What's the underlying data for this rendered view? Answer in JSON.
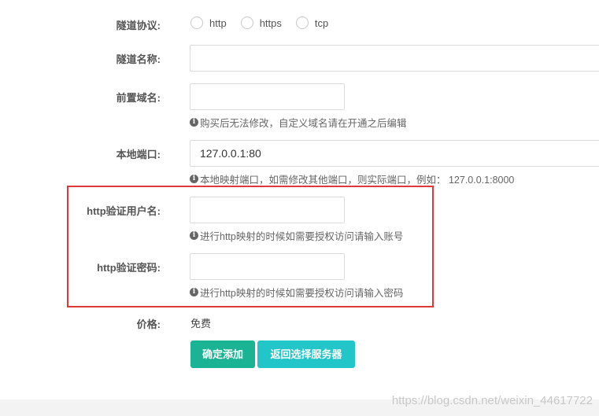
{
  "form": {
    "protocol": {
      "label": "隧道协议:",
      "options": [
        "http",
        "https",
        "tcp"
      ]
    },
    "tunnel_name": {
      "label": "隧道名称:",
      "value": ""
    },
    "prefix_domain": {
      "label": "前置域名:",
      "value": "",
      "help": "购买后无法修改，自定义域名请在开通之后编辑"
    },
    "local_port": {
      "label": "本地端口:",
      "value": "127.0.0.1:80",
      "help": "本地映射端口，如需修改其他端口，则实际端口，例如： 127.0.0.1:8000"
    },
    "http_user": {
      "label": "http验证用户名:",
      "value": "",
      "help": "进行http映射的时候如需要授权访问请输入账号"
    },
    "http_password": {
      "label": "http验证密码:",
      "value": "",
      "help": "进行http映射的时候如需要授权访问请输入密码"
    },
    "price": {
      "label": "价格:",
      "value": "免费"
    }
  },
  "buttons": {
    "confirm": "确定添加",
    "back": "返回选择服务器"
  },
  "info_icon": "i",
  "watermark": "https://blog.csdn.net/weixin_44617722",
  "colors": {
    "primary": "#1ab394",
    "info": "#23c6c8",
    "highlight": "#e0393a"
  }
}
